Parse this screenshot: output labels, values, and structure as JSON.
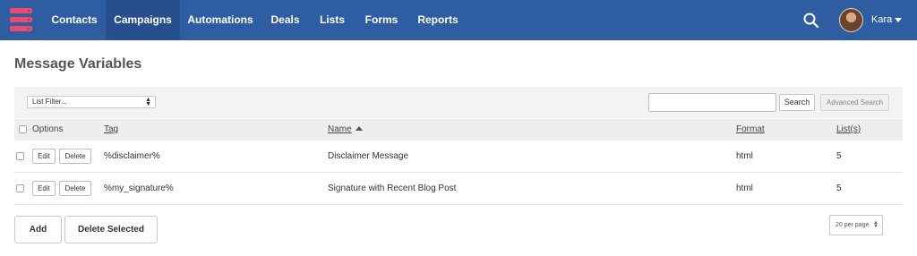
{
  "nav": {
    "items": [
      {
        "label": "Contacts",
        "active": false
      },
      {
        "label": "Campaigns",
        "active": true
      },
      {
        "label": "Automations",
        "active": false
      },
      {
        "label": "Deals",
        "active": false
      },
      {
        "label": "Lists",
        "active": false
      },
      {
        "label": "Forms",
        "active": false
      },
      {
        "label": "Reports",
        "active": false
      }
    ],
    "user_name": "Kara",
    "search_icon": "search-icon",
    "brand_color": "#2f5da2",
    "logo_color": "#f0476c"
  },
  "page": {
    "title": "Message Variables"
  },
  "toolbar": {
    "list_filter_value": "List Filter...",
    "search_value": "",
    "search_button": "Search",
    "advanced_search_button": "Advanced Search"
  },
  "table": {
    "headers": {
      "options": "Options",
      "tag": "Tag",
      "name": "Name",
      "format": "Format",
      "lists": "List(s)"
    },
    "sort": {
      "column": "name",
      "direction": "ascending"
    },
    "edit_label": "Edit",
    "delete_label": "Delete",
    "rows": [
      {
        "tag": "%disclaimer%",
        "name": "Disclaimer Message",
        "format": "html",
        "lists": "5"
      },
      {
        "tag": "%my_signature%",
        "name": "Signature with Recent Blog Post",
        "format": "html",
        "lists": "5"
      }
    ]
  },
  "footer": {
    "add_button": "Add",
    "delete_selected_button": "Delete Selected",
    "per_page_value": "20 per page"
  }
}
